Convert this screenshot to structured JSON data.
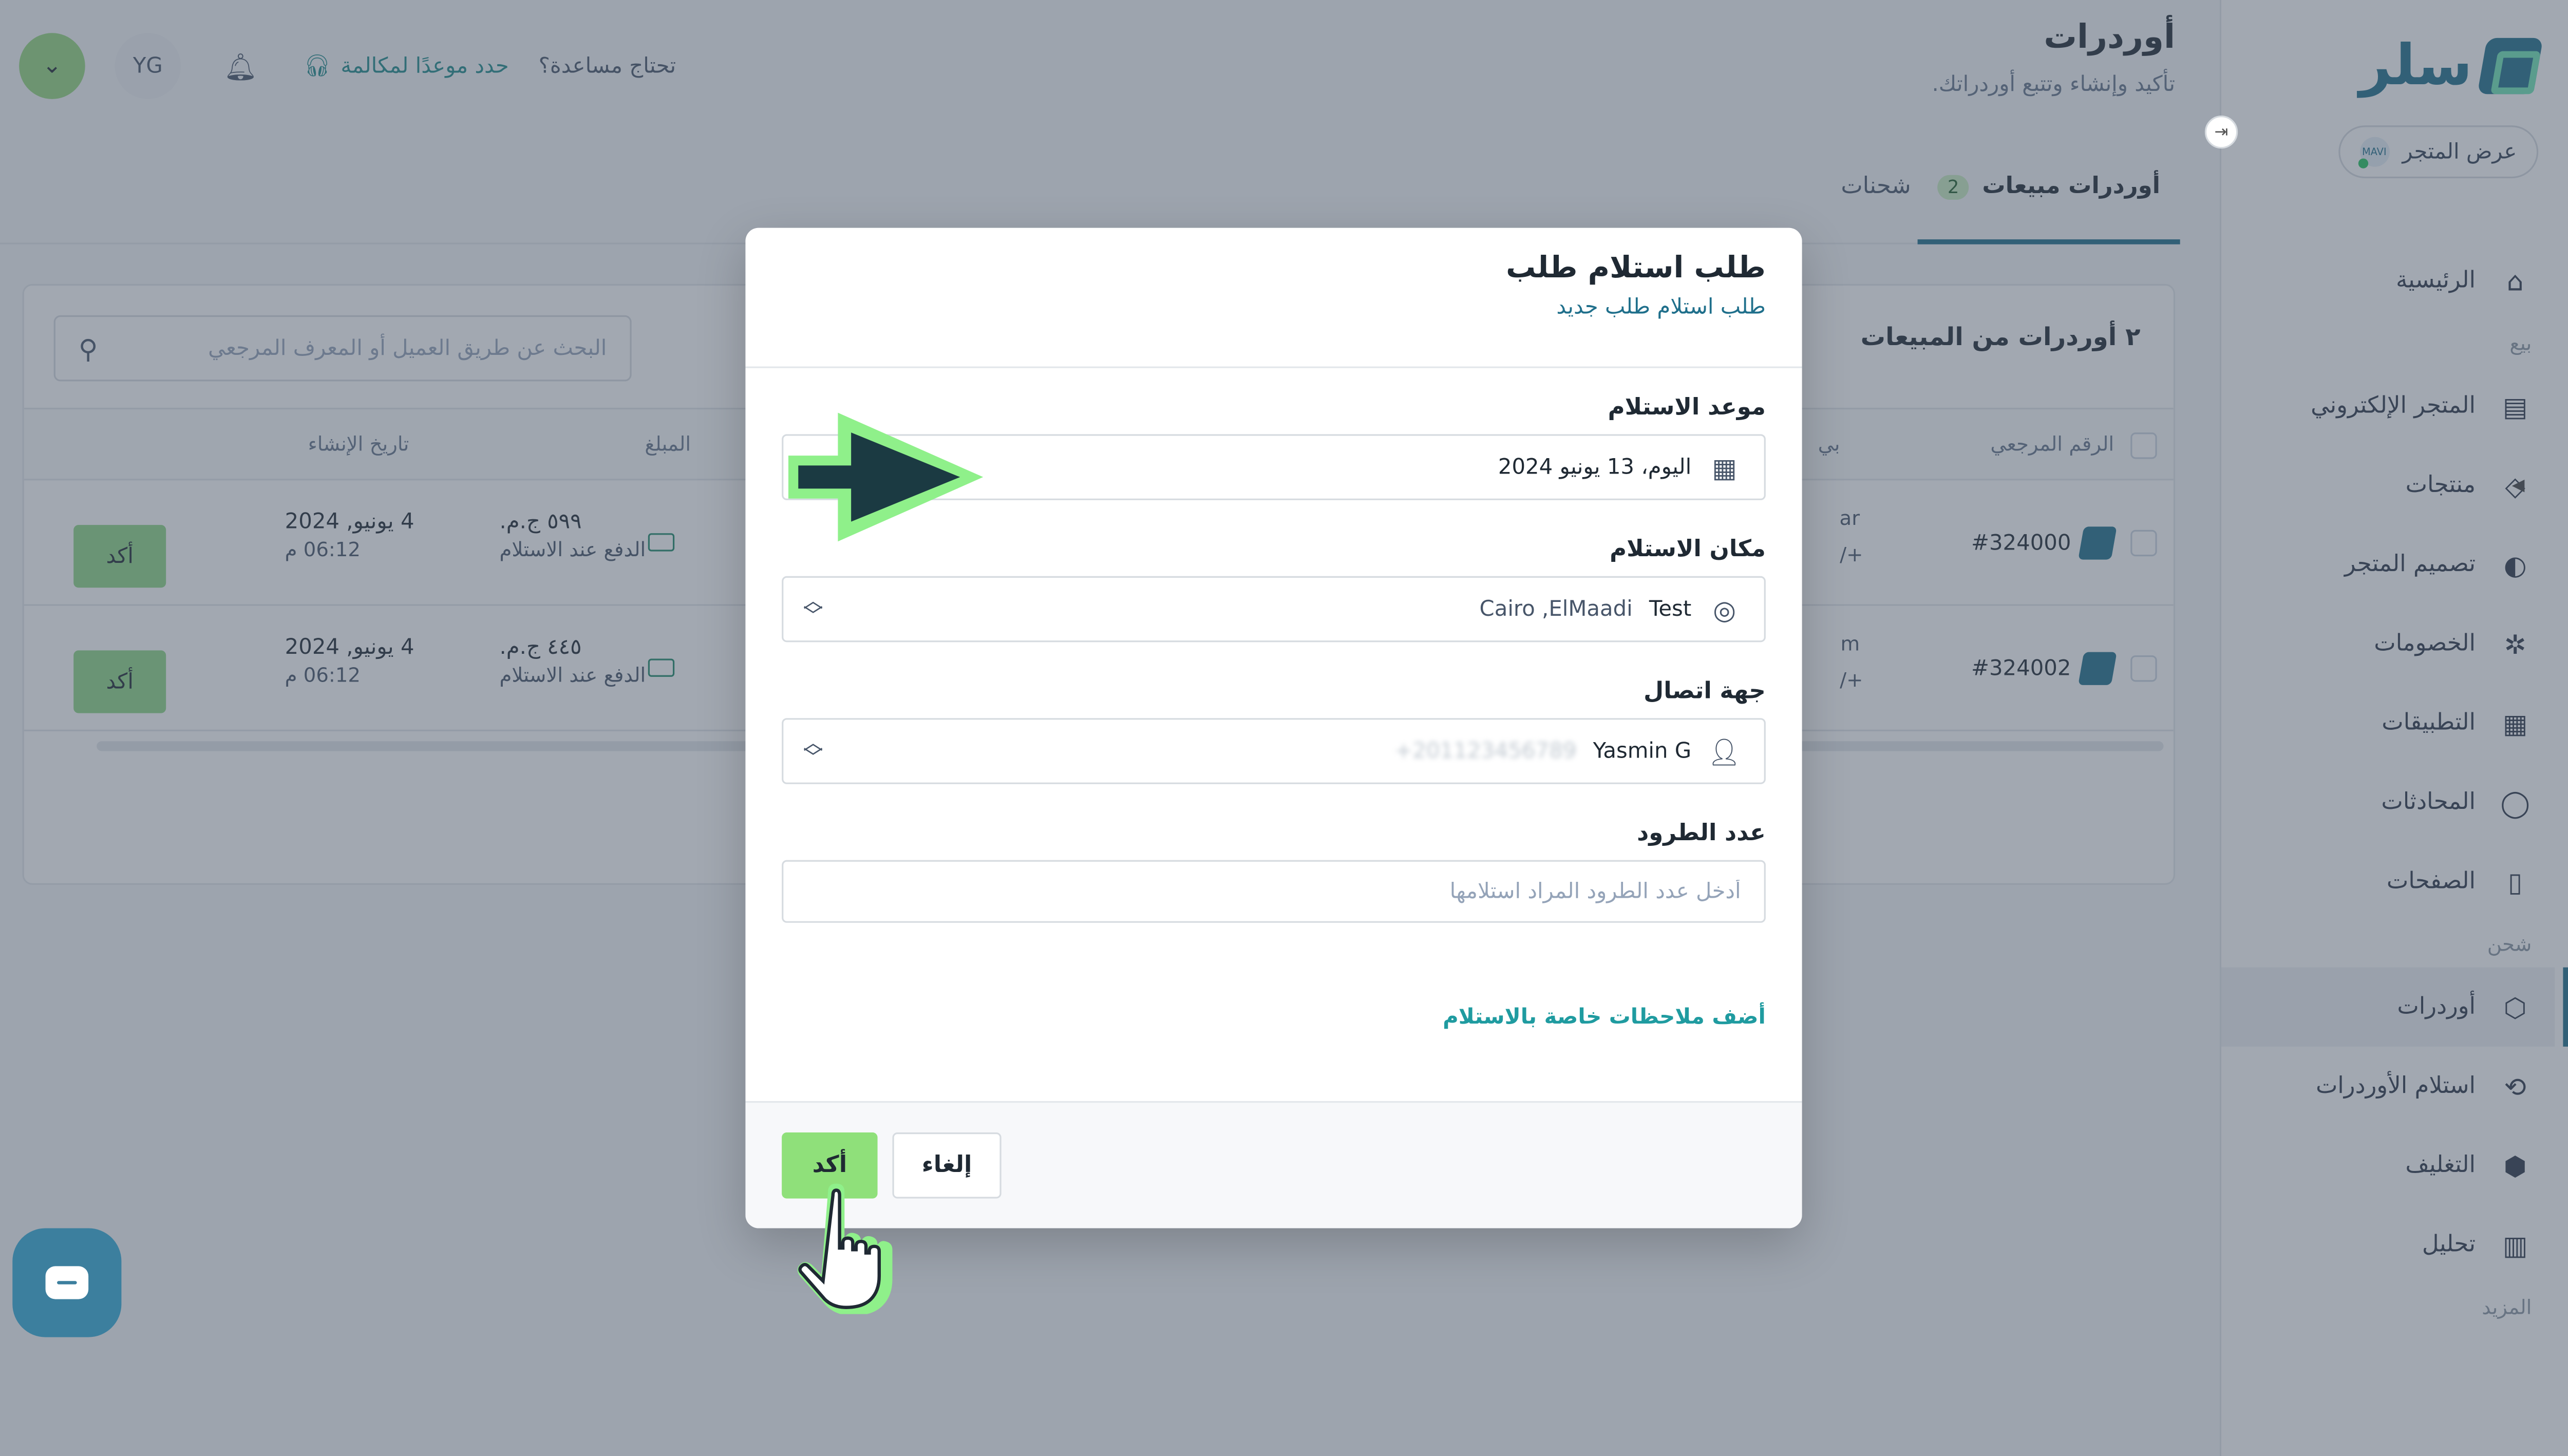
{
  "brand": {
    "logo_text": "سلر",
    "store_button": "عرض المتجر",
    "store_badge": "MAVI"
  },
  "sidebar": {
    "collapse_icon": "⇥",
    "items": [
      {
        "label": "الرئيسية",
        "icon": "home-icon",
        "glyph": "⌂"
      },
      {
        "section": "بيع"
      },
      {
        "label": "المتجر الإلكتروني",
        "icon": "store-icon",
        "glyph": "▤"
      },
      {
        "label": "منتجات",
        "icon": "tag-icon",
        "glyph": "◇",
        "expandable": true
      },
      {
        "label": "تصميم المتجر",
        "icon": "palette-icon",
        "glyph": "◐"
      },
      {
        "label": "الخصومات",
        "icon": "discount-icon",
        "glyph": "✲"
      },
      {
        "label": "التطبيقات",
        "icon": "apps-icon",
        "glyph": "▦"
      },
      {
        "label": "المحادثات",
        "icon": "chat-icon",
        "glyph": "◯"
      },
      {
        "label": "الصفحات",
        "icon": "pages-icon",
        "glyph": "▯"
      },
      {
        "section": "شحن"
      },
      {
        "label": "أوردرات",
        "icon": "box-icon",
        "glyph": "⬡",
        "active": true
      },
      {
        "label": "استلام الأوردرات",
        "icon": "pickup-icon",
        "glyph": "⟲"
      },
      {
        "label": "التغليف",
        "icon": "package-icon",
        "glyph": "⬢"
      },
      {
        "label": "تحليل",
        "icon": "analytics-icon",
        "glyph": "▥"
      },
      {
        "section": "المزيد"
      }
    ]
  },
  "header": {
    "title": "أوردرات",
    "subtitle": "تأكيد وإنشاء وتتبع أوردراتك.",
    "need_help": "تحتاج مساعدة؟",
    "book_call": "حدد موعدًا لمكالمة",
    "avatar": "YG",
    "menu_chevron": "⌄"
  },
  "tabs": [
    {
      "label": "أوردرات مبيعات",
      "badge": "2",
      "active": true
    },
    {
      "label": "شحنات"
    }
  ],
  "orders": {
    "title": "٢ أوردرات من المبيعات",
    "search_placeholder": "البحث عن طريق العميل أو المعرف المرجعي",
    "columns": {
      "ref": "الرقم المرجعي",
      "customer": "بي",
      "amount": "المبلغ",
      "created": "تاريخ الإنشاء"
    },
    "rows": [
      {
        "ref": "#324000",
        "customer_cut": "ar",
        "customer_cut2": "+/",
        "amount": "٥٩٩ ج.م.",
        "payment": "الدفع عند الاستلام",
        "date": "4 يونيو, 2024",
        "time": "06:12 م",
        "action": "أكد"
      },
      {
        "ref": "#324002",
        "customer_cut": "m",
        "customer_cut2": "+/",
        "amount": "٤٤٥ ج.م.",
        "payment": "الدفع عند الاستلام",
        "date": "4 يونيو, 2024",
        "time": "06:12 م",
        "action": "أكد"
      }
    ]
  },
  "modal": {
    "title": "طلب استلام طلب",
    "subtitle": "طلب استلام طلب جديد",
    "pickup_date_label": "موعد الاستلام",
    "pickup_date_value": "اليوم، 13 يونيو 2024",
    "pickup_location_label": "مكان الاستلام",
    "location_name": "Test",
    "location_address": "Cairo ,ElMaadi",
    "contact_label": "جهة اتصال",
    "contact_name": "Yasmin G",
    "contact_phone": "+201123456789",
    "parcels_label": "عدد الطرود",
    "parcels_placeholder": "أدخل عدد الطرود المراد استلامها",
    "parcels_value": "",
    "notes_link": "أضف ملاحظات خاصة بالاستلام",
    "confirm": "أكد",
    "cancel": "إلغاء"
  },
  "colors": {
    "brand": "#1f6f8b",
    "confirm_green": "#8fe07a",
    "link_teal": "#1f9ba0",
    "overlay": "#465264",
    "tutorial_arrow": "#8ff08a"
  }
}
